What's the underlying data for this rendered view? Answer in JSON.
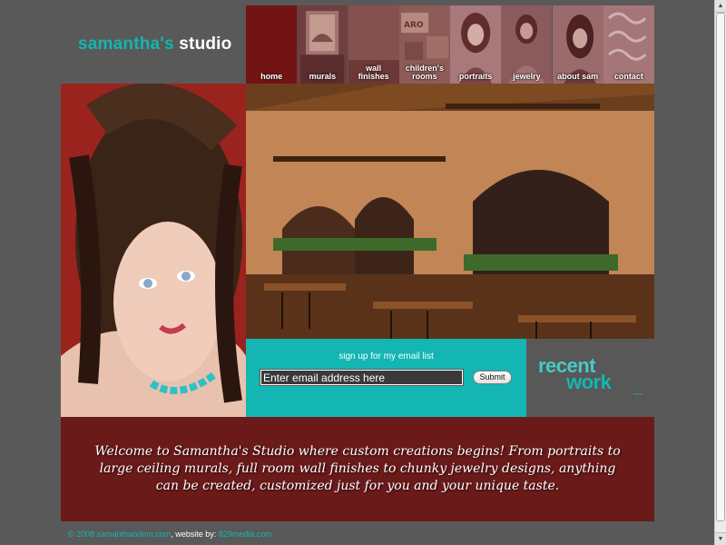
{
  "logo": {
    "part1": "samantha's",
    "part2": "studio"
  },
  "nav": {
    "items": [
      {
        "line1": "home",
        "line2": ""
      },
      {
        "line1": "murals",
        "line2": ""
      },
      {
        "line1": "wall",
        "line2": "finishes"
      },
      {
        "line1": "children's",
        "line2": "rooms"
      },
      {
        "line1": "portraits",
        "line2": ""
      },
      {
        "line1": "jewelry",
        "line2": ""
      },
      {
        "line1": "about sam",
        "line2": ""
      },
      {
        "line1": "contact",
        "line2": ""
      }
    ]
  },
  "signup": {
    "title": "sign up for my email list",
    "input_value": "Enter email address here",
    "submit_label": "Submit"
  },
  "recent_work": {
    "line1": "recent",
    "line2": "work",
    "underscore": "_"
  },
  "welcome": {
    "text": "Welcome to Samantha's Studio where custom creations begins! From portraits to large ceiling murals, full room wall finishes to chunky jewelry designs, anything can be created, customized just for you and your unique taste."
  },
  "footer": {
    "copyright": "© 2008 samanthaodom.com",
    "separator": ", website by: ",
    "credit": "829media.com"
  },
  "colors": {
    "teal": "#13b6b2",
    "maroon": "#6b1a1a",
    "background": "#595959"
  }
}
